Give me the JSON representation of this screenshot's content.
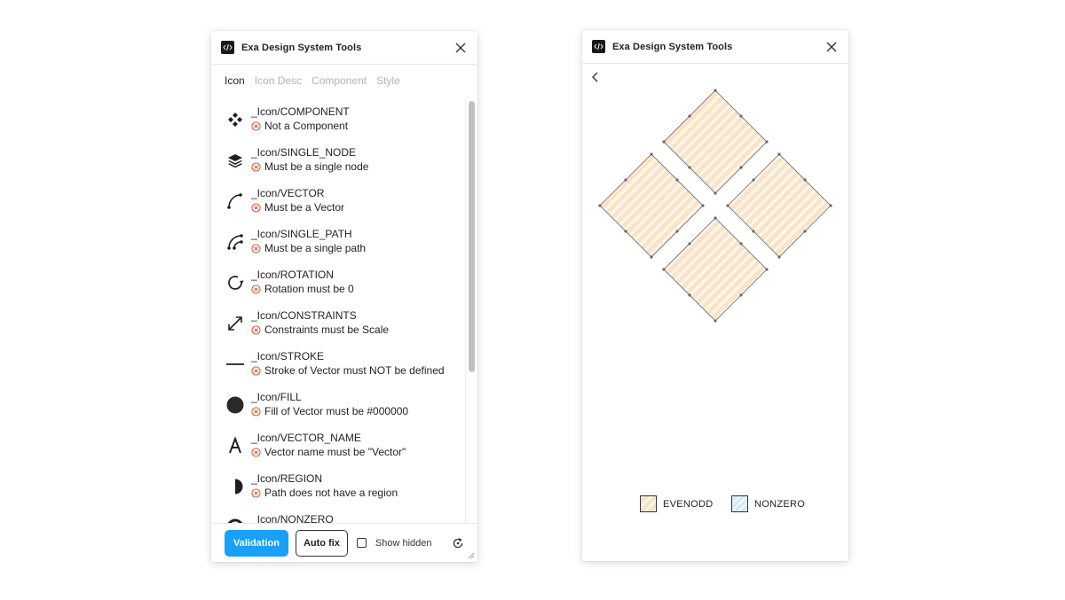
{
  "left_panel": {
    "title": "Exa Design System Tools",
    "tabs": [
      {
        "label": "Icon",
        "active": true
      },
      {
        "label": "Icon Desc",
        "active": false
      },
      {
        "label": "Component",
        "active": false
      },
      {
        "label": "Style",
        "active": false
      }
    ],
    "items": [
      {
        "name": "_Icon/COMPONENT",
        "error": "Not a Component",
        "icon": "component-icon"
      },
      {
        "name": "_Icon/SINGLE_NODE",
        "error": "Must be a single node",
        "icon": "layers-icon"
      },
      {
        "name": "_Icon/VECTOR",
        "error": "Must be a Vector",
        "icon": "vector-path-icon"
      },
      {
        "name": "_Icon/SINGLE_PATH",
        "error": "Must be a single path",
        "icon": "multi-path-icon"
      },
      {
        "name": "_Icon/ROTATION",
        "error": "Rotation must be 0",
        "icon": "rotation-icon"
      },
      {
        "name": "_Icon/CONSTRAINTS",
        "error": "Constraints must be Scale",
        "icon": "scale-arrows-icon"
      },
      {
        "name": "_Icon/STROKE",
        "error": "Stroke of Vector must NOT be defined",
        "icon": "stroke-line-icon"
      },
      {
        "name": "_Icon/FILL",
        "error": "Fill of Vector must be #000000",
        "icon": "fill-circle-icon"
      },
      {
        "name": "_Icon/VECTOR_NAME",
        "error": "Vector name must be \"Vector\"",
        "icon": "letter-a-icon"
      },
      {
        "name": "_Icon/REGION",
        "error": "Path does not have a region",
        "icon": "half-circle-icon"
      },
      {
        "name": "_Icon/NONZERO",
        "error": "",
        "icon": "nonzero-icon"
      }
    ],
    "footer": {
      "validation_label": "Validation",
      "autofix_label": "Auto fix",
      "show_hidden_label": "Show hidden",
      "show_hidden_checked": false
    }
  },
  "right_panel": {
    "title": "Exa Design System Tools",
    "legend": [
      {
        "label": "EVENODD",
        "pattern": "orange-stripes"
      },
      {
        "label": "NONZERO",
        "pattern": "blue-stripes"
      }
    ]
  },
  "colors": {
    "primary": "#18a0fb",
    "error": "#e03e1a",
    "evenodd_fill": "#fbe3c6",
    "evenodd_stripe": "#ffffff",
    "nonzero_fill": "#d2e9f8"
  }
}
